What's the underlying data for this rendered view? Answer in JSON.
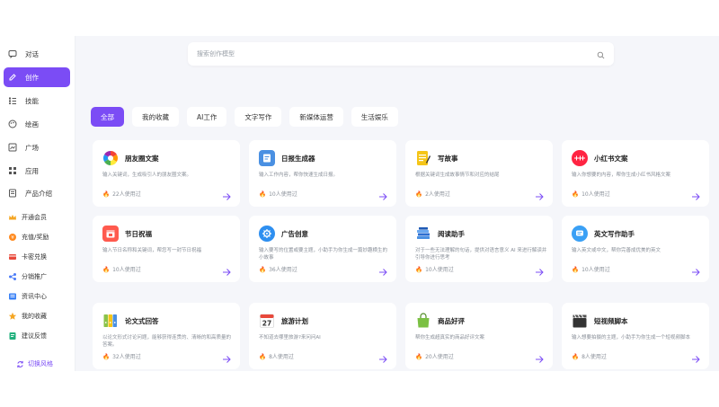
{
  "sidebar": {
    "items": [
      {
        "label": "对话",
        "icon": "chat-icon"
      },
      {
        "label": "创作",
        "icon": "create-icon"
      },
      {
        "label": "技能",
        "icon": "skills-icon"
      },
      {
        "label": "绘画",
        "icon": "palette-icon"
      },
      {
        "label": "广场",
        "icon": "square-icon"
      },
      {
        "label": "应用",
        "icon": "apps-icon"
      },
      {
        "label": "产品介绍",
        "icon": "product-icon"
      },
      {
        "label": "开通会员",
        "icon": "crown-icon"
      },
      {
        "label": "充值/奖励",
        "icon": "recharge-icon"
      },
      {
        "label": "卡密兑换",
        "icon": "card-icon"
      },
      {
        "label": "分销推广",
        "icon": "share-icon"
      },
      {
        "label": "资讯中心",
        "icon": "news-icon"
      },
      {
        "label": "我的收藏",
        "icon": "star-icon"
      },
      {
        "label": "建议反馈",
        "icon": "feedback-icon"
      }
    ],
    "switch_style": "切换风格"
  },
  "search": {
    "placeholder": "搜索创作模型"
  },
  "tabs": [
    "全部",
    "我的收藏",
    "AI工作",
    "文字写作",
    "新媒体运营",
    "生活娱乐"
  ],
  "accent": "#7b4cf5",
  "cards": [
    {
      "title": "朋友圈文案",
      "desc": "输入关键词，生成吸引人的朋友圈文案。",
      "used": "22人使用过",
      "icon": "rainbow-circle-icon"
    },
    {
      "title": "日报生成器",
      "desc": "输入工作内容，帮你快速生成日报。",
      "used": "10人使用过",
      "icon": "daily-report-icon"
    },
    {
      "title": "写故事",
      "desc": "根据关键词生成故事情节和对应的结尾",
      "used": "2人使用过",
      "icon": "notepad-icon"
    },
    {
      "title": "小红书文案",
      "desc": "输入你想要的内容，帮你生成小红书风格文案",
      "used": "10人使用过",
      "icon": "xiaohongshu-icon"
    },
    {
      "title": "节日祝福",
      "desc": "输入节日名称和关键词，帮您写一封节日祝福",
      "used": "10人使用过",
      "icon": "calendar-icon"
    },
    {
      "title": "广告创意",
      "desc": "输入要写的位置或要主题，小助手为你生成一篇妙趣横生的小故事",
      "used": "36人使用过",
      "icon": "gear-icon"
    },
    {
      "title": "阅读助手",
      "desc": "对于一些无法理解的句话，提供对语言意义 AI 来进行解读并引导你进行思考",
      "used": "10人使用过",
      "icon": "books-icon"
    },
    {
      "title": "英文写作助手",
      "desc": "输入英文或中文，帮你完善成优美的英文",
      "used": "10人使用过",
      "icon": "message-icon"
    },
    {
      "title": "论文式回答",
      "desc": "以论文形式讨论问题，能够获得连贯的、清晰的和高质量的答案。",
      "used": "32人使用过",
      "icon": "binders-icon"
    },
    {
      "title": "旅游计划",
      "desc": "不知道去哪里旅游?来问问AI",
      "used": "8人使用过",
      "icon": "calendar-27-icon"
    },
    {
      "title": "商品好评",
      "desc": "帮你生成超真实的商品好评文案",
      "used": "20人使用过",
      "icon": "shopping-bag-icon"
    },
    {
      "title": "短视频脚本",
      "desc": "输入想要拍摄的主题，小助手为你生成一个短视频脚本",
      "used": "8人使用过",
      "icon": "clapperboard-icon"
    }
  ]
}
